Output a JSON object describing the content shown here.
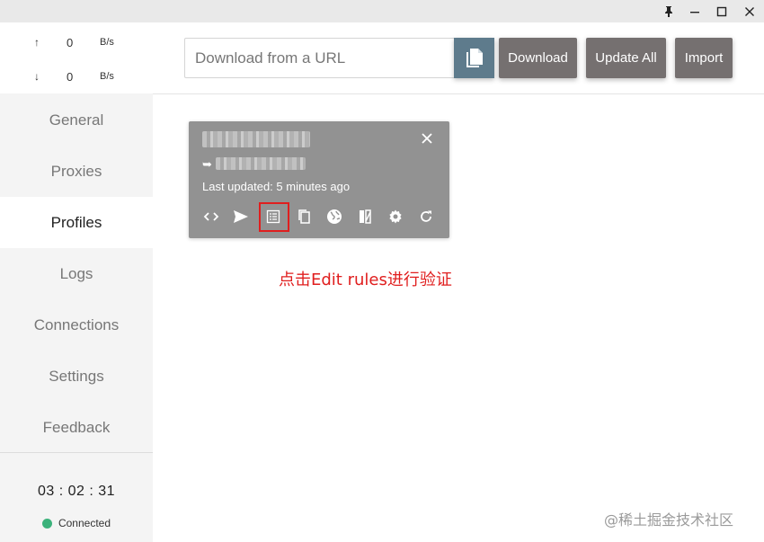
{
  "window": {
    "pin_icon": "pin-icon",
    "minimize_icon": "minimize-icon",
    "maximize_icon": "maximize-icon",
    "close_icon": "close-icon"
  },
  "traffic": {
    "up_arrow": "↑",
    "up_value": "0",
    "up_unit": "B/s",
    "down_arrow": "↓",
    "down_value": "0",
    "down_unit": "B/s"
  },
  "nav": {
    "items": [
      {
        "label": "General"
      },
      {
        "label": "Proxies"
      },
      {
        "label": "Profiles"
      },
      {
        "label": "Logs"
      },
      {
        "label": "Connections"
      },
      {
        "label": "Settings"
      },
      {
        "label": "Feedback"
      }
    ],
    "active": "Profiles"
  },
  "footer": {
    "clock": "03 : 02 : 31",
    "status": "Connected",
    "status_color": "#3bb27b"
  },
  "toolbar": {
    "url_placeholder": "Download from a URL",
    "download_label": "Download",
    "update_all_label": "Update All",
    "import_label": "Import",
    "paste_icon": "paste-icon"
  },
  "profile_card": {
    "url_arrow": "➥",
    "last_updated": "Last updated: 5 minutes ago",
    "icons": [
      "code-icon",
      "send-icon",
      "edit-rules-icon",
      "copy-icon",
      "globe-icon",
      "parser-icon",
      "settings-icon",
      "refresh-icon"
    ]
  },
  "annotation": "点击Edit rules进行验证",
  "watermark": "@稀土掘金技术社区",
  "colors": {
    "card_bg": "#929292",
    "button_bg": "#757070",
    "paste_bg": "#5e7b8c",
    "highlight": "#e01e1e"
  }
}
